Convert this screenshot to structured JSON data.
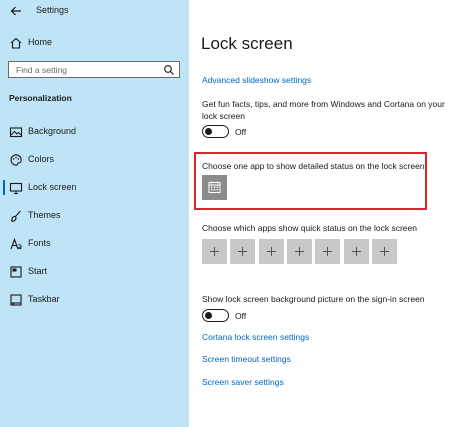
{
  "header": {
    "title": "Settings"
  },
  "sidebar": {
    "home_label": "Home",
    "search_placeholder": "Find a setting",
    "section_heading": "Personalization",
    "items": [
      {
        "label": "Background",
        "icon": "picture-icon"
      },
      {
        "label": "Colors",
        "icon": "palette-icon"
      },
      {
        "label": "Lock screen",
        "icon": "monitor-icon",
        "selected": true
      },
      {
        "label": "Themes",
        "icon": "brush-icon"
      },
      {
        "label": "Fonts",
        "icon": "font-icon"
      },
      {
        "label": "Start",
        "icon": "start-icon"
      },
      {
        "label": "Taskbar",
        "icon": "taskbar-icon"
      }
    ]
  },
  "main": {
    "title": "Lock screen",
    "advanced_slideshow_link": "Advanced slideshow settings",
    "fun_facts_text": "Get fun facts, tips, and more from Windows and Cortana on your lock screen",
    "fun_facts_toggle": "Off",
    "detailed_status_label": "Choose one app to show detailed status on the lock screen",
    "detailed_status_app_icon": "calendar-icon",
    "quick_status_label": "Choose which apps show quick status on the lock screen",
    "quick_status_slots": 7,
    "signin_bg_label": "Show lock screen background picture on the sign-in screen",
    "signin_bg_toggle": "Off",
    "cortana_link": "Cortana lock screen settings",
    "timeout_link": "Screen timeout settings",
    "saver_link": "Screen saver settings"
  },
  "colors": {
    "accent": "#0067c0",
    "sidebar_bg": "#bfe4f6",
    "highlight": "#d9262c"
  }
}
